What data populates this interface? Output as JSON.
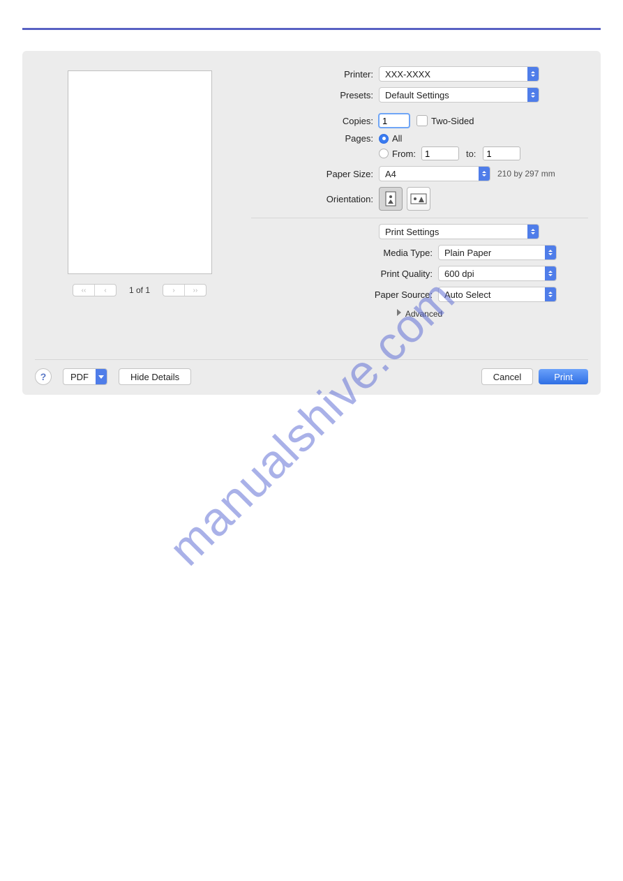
{
  "watermark": "manualshive.com",
  "labels": {
    "printer": "Printer:",
    "presets": "Presets:",
    "copies": "Copies:",
    "twoSided": "Two-Sided",
    "pages": "Pages:",
    "all": "All",
    "from": "From:",
    "to": "to:",
    "paperSize": "Paper Size:",
    "orientation": "Orientation:",
    "mediaType": "Media Type:",
    "printQuality": "Print Quality:",
    "paperSource": "Paper Source:",
    "advanced": "Advanced"
  },
  "values": {
    "printer": "XXX-XXXX",
    "presets": "Default Settings",
    "copies": "1",
    "fromPage": "1",
    "toPage": "1",
    "paperSize": "A4",
    "paperDim": "210 by 297 mm",
    "sectionDropdown": "Print Settings",
    "mediaType": "Plain Paper",
    "printQuality": "600 dpi",
    "paperSource": "Auto Select"
  },
  "pager": {
    "text": "1 of 1"
  },
  "footer": {
    "help": "?",
    "pdf": "PDF",
    "hideDetails": "Hide Details",
    "cancel": "Cancel",
    "print": "Print"
  }
}
